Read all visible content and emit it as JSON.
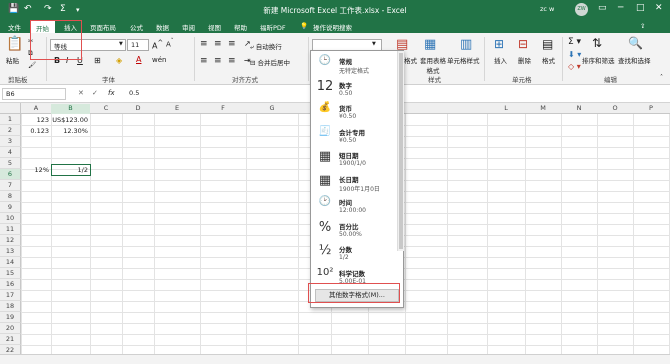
{
  "title_bar": {
    "title": "新建 Microsoft Excel 工作表.xlsx - Excel",
    "user": "zc w",
    "avatar": "ZW"
  },
  "tabs": [
    "文件",
    "开始",
    "插入",
    "页面布局",
    "公式",
    "数据",
    "审阅",
    "视图",
    "帮助",
    "福昕PDF"
  ],
  "tell_me": "操作说明搜索",
  "ribbon": {
    "paste": "粘贴",
    "clipboard": "剪贴板",
    "font_name": "等线",
    "font_size": "11",
    "font_group": "字体",
    "align_group": "对齐方式",
    "wrap_text": "自动换行",
    "merge_center": "合并后居中",
    "cond_format": "格式",
    "table_format": "套用表格格式",
    "cell_styles": "单元格样式",
    "styles_group": "样式",
    "insert": "插入",
    "delete": "删除",
    "format": "格式",
    "cells_group": "单元格",
    "sort_filter": "排序和筛选",
    "find_select": "查找和选择",
    "editing_group": "编辑"
  },
  "formula_bar": {
    "name_box": "B6",
    "fx": "fx",
    "value": "0.5"
  },
  "columns": [
    "A",
    "B",
    "C",
    "D",
    "E",
    "F",
    "G",
    "",
    "",
    "",
    "",
    "",
    "L",
    "M",
    "N",
    "O",
    "P"
  ],
  "rows": [
    "1",
    "2",
    "3",
    "4",
    "5",
    "6",
    "7",
    "8",
    "9",
    "10",
    "11",
    "12",
    "13",
    "14",
    "15",
    "16",
    "17",
    "18",
    "19",
    "20",
    "21",
    "22"
  ],
  "cells": {
    "a1": "123",
    "b1": "US$123.00",
    "a2": "0.123",
    "b2": "12.30%",
    "a6": "12%",
    "b6": "1/2"
  },
  "number_formats": [
    {
      "icon": "clock-icon",
      "glyph": "🕒",
      "name": "常规",
      "example": "无特定格式"
    },
    {
      "icon": "number-icon",
      "glyph": "12",
      "name": "数字",
      "example": "0.50"
    },
    {
      "icon": "currency-icon",
      "glyph": "💰",
      "name": "货币",
      "example": "¥0.50"
    },
    {
      "icon": "accounting-icon",
      "glyph": "🧾",
      "name": "会计专用",
      "example": "¥0.50"
    },
    {
      "icon": "short-date-icon",
      "glyph": "▦",
      "name": "短日期",
      "example": "1900/1/0"
    },
    {
      "icon": "long-date-icon",
      "glyph": "▦",
      "name": "长日期",
      "example": "1900年1月0日"
    },
    {
      "icon": "time-icon",
      "glyph": "🕑",
      "name": "时间",
      "example": "12:00:00"
    },
    {
      "icon": "percent-icon",
      "glyph": "%",
      "name": "百分比",
      "example": "50.00%"
    },
    {
      "icon": "fraction-icon",
      "glyph": "½",
      "name": "分数",
      "example": "1/2"
    },
    {
      "icon": "scientific-icon",
      "glyph": "10²",
      "name": "科学记数",
      "example": "5.00E-01"
    }
  ],
  "more_formats": "其他数字格式(M)..."
}
